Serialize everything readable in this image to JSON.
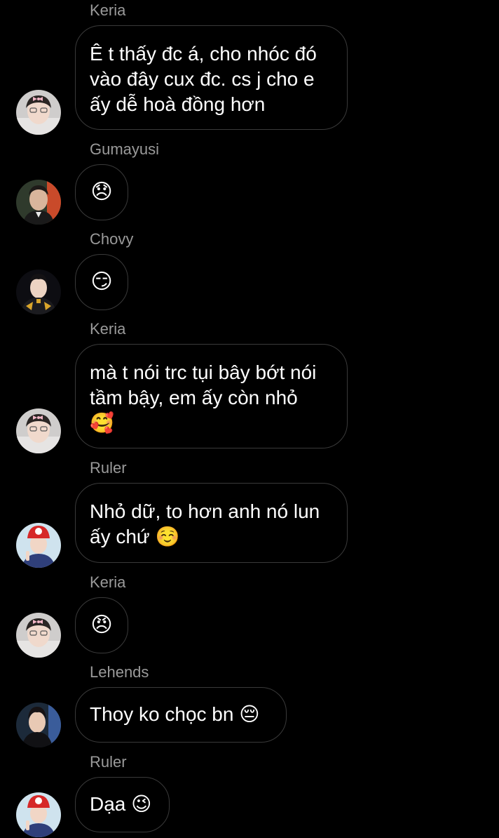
{
  "messages": [
    {
      "sender": "Keria",
      "lines": [
        "Ê t thấy đc á, cho nhóc đó",
        "vào đây cux đc. cs j cho e",
        "ấy dễ hoà đồng hơn"
      ]
    },
    {
      "sender": "Gumayusi",
      "lines": [
        "😞"
      ]
    },
    {
      "sender": "Chovy",
      "lines": [
        "😏"
      ]
    },
    {
      "sender": "Keria",
      "lines": [
        "mà t nói trc tụi bây bớt nói",
        "tầm bậy, em ấy còn nhỏ",
        "🥰"
      ]
    },
    {
      "sender": "Ruler",
      "lines": [
        "Nhỏ dữ, to hơn anh nó lun",
        "ấy chứ ☺️"
      ]
    },
    {
      "sender": "Keria",
      "lines": [
        "😠"
      ]
    },
    {
      "sender": "Lehends",
      "lines": [
        "Thoy ko chọc bn 😔"
      ]
    },
    {
      "sender": "Ruler",
      "lines": [
        "Dạa 😉"
      ]
    }
  ],
  "avatars": {
    "keria": "profile-photo-keria",
    "gumayusi": "profile-photo-gumayusi",
    "chovy": "profile-photo-chovy",
    "ruler": "profile-photo-ruler",
    "lehends": "profile-photo-lehends"
  },
  "colors": {
    "background": "#000000",
    "bubble_border": "#3a3a3a",
    "sender_name": "#9a9a9a",
    "message_text": "#ffffff"
  }
}
